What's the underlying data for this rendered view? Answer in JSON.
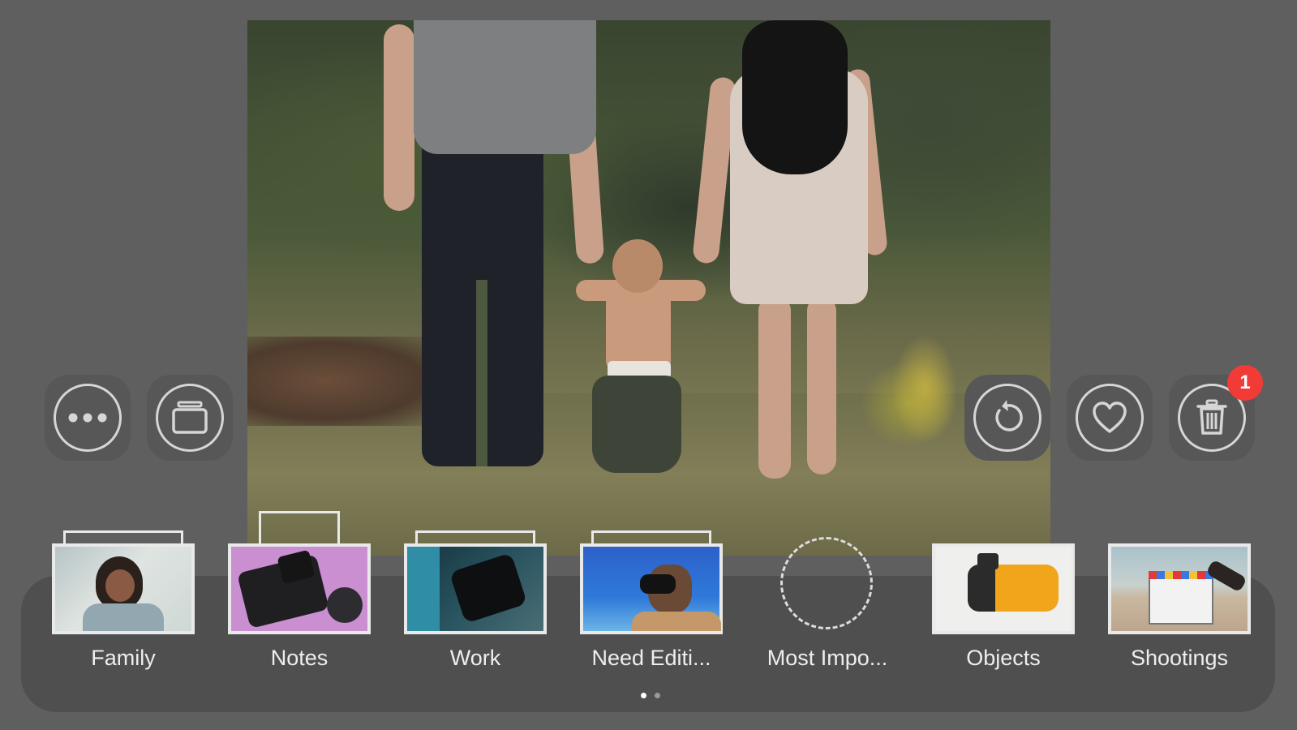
{
  "actions": {
    "more": {
      "icon": "more-dots-icon"
    },
    "albums": {
      "icon": "album-stack-icon"
    },
    "undo": {
      "icon": "undo-rotate-icon"
    },
    "favorite": {
      "icon": "heart-icon"
    },
    "trash": {
      "icon": "trash-icon",
      "badge": "1"
    }
  },
  "albums": [
    {
      "label": "Family",
      "thumbnail": "person-portrait"
    },
    {
      "label": "Notes",
      "thumbnail": "camera-rig"
    },
    {
      "label": "Work",
      "thumbnail": "camera-closeup"
    },
    {
      "label": "Need Editi...",
      "thumbnail": "underwater-diver"
    },
    {
      "label": "Most Impo...",
      "thumbnail": "empty-placeholder"
    },
    {
      "label": "Objects",
      "thumbnail": "film-canister"
    },
    {
      "label": "Shootings",
      "thumbnail": "clapperboard"
    }
  ],
  "pager": {
    "pages": 2,
    "current": 1
  },
  "colors": {
    "background": "#5f5f5f",
    "tray": "#4f4f4f",
    "badge": "#f23b36",
    "icon": "#d6d6d6"
  }
}
